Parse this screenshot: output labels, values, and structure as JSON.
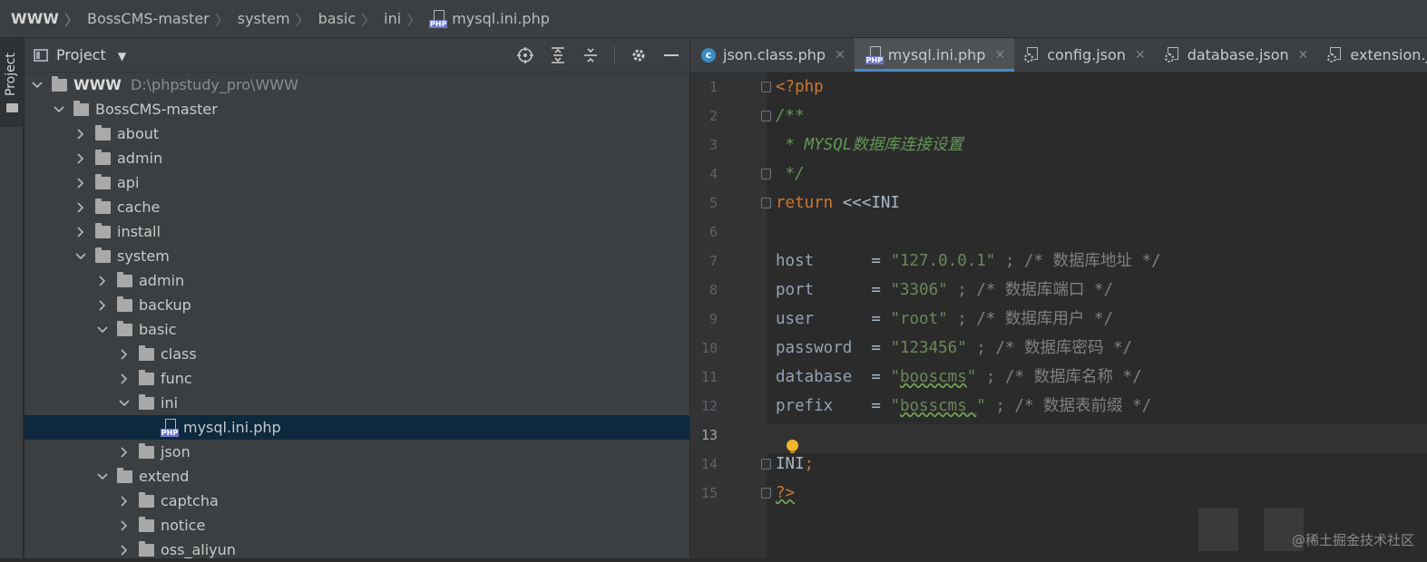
{
  "breadcrumb": {
    "items": [
      "WWW",
      "BossCMS-master",
      "system",
      "basic",
      "ini",
      "mysql.ini.php"
    ]
  },
  "toolstrip": {
    "project_tab": "Project"
  },
  "project_panel": {
    "title": "Project",
    "tree": [
      {
        "label": "WWW",
        "hint": "D:\\phpstudy_pro\\WWW",
        "depth": 0,
        "state": "open",
        "type": "folder"
      },
      {
        "label": "BossCMS-master",
        "depth": 1,
        "state": "open",
        "type": "folder"
      },
      {
        "label": "about",
        "depth": 2,
        "state": "closed",
        "type": "folder"
      },
      {
        "label": "admin",
        "depth": 2,
        "state": "closed",
        "type": "folder"
      },
      {
        "label": "api",
        "depth": 2,
        "state": "closed",
        "type": "folder"
      },
      {
        "label": "cache",
        "depth": 2,
        "state": "closed",
        "type": "folder"
      },
      {
        "label": "install",
        "depth": 2,
        "state": "closed",
        "type": "folder"
      },
      {
        "label": "system",
        "depth": 2,
        "state": "open",
        "type": "folder"
      },
      {
        "label": "admin",
        "depth": 3,
        "state": "closed",
        "type": "folder"
      },
      {
        "label": "backup",
        "depth": 3,
        "state": "closed",
        "type": "folder"
      },
      {
        "label": "basic",
        "depth": 3,
        "state": "open",
        "type": "folder"
      },
      {
        "label": "class",
        "depth": 4,
        "state": "closed",
        "type": "folder"
      },
      {
        "label": "func",
        "depth": 4,
        "state": "closed",
        "type": "folder"
      },
      {
        "label": "ini",
        "depth": 4,
        "state": "open",
        "type": "folder"
      },
      {
        "label": "mysql.ini.php",
        "depth": 5,
        "state": "leaf",
        "type": "php",
        "selected": true
      },
      {
        "label": "json",
        "depth": 4,
        "state": "closed",
        "type": "folder"
      },
      {
        "label": "extend",
        "depth": 3,
        "state": "open",
        "type": "folder"
      },
      {
        "label": "captcha",
        "depth": 4,
        "state": "closed",
        "type": "folder"
      },
      {
        "label": "notice",
        "depth": 4,
        "state": "closed",
        "type": "folder"
      },
      {
        "label": "oss_aliyun",
        "depth": 4,
        "state": "closed",
        "type": "folder"
      }
    ]
  },
  "tabs": [
    {
      "label": "json.class.php",
      "icon": "class-icon",
      "active": false
    },
    {
      "label": "mysql.ini.php",
      "icon": "php-file-icon",
      "active": true
    },
    {
      "label": "config.json",
      "icon": "config-file-icon",
      "active": false
    },
    {
      "label": "database.json",
      "icon": "config-file-icon",
      "active": false
    },
    {
      "label": "extension.json",
      "icon": "config-file-icon",
      "active": false
    }
  ],
  "code": {
    "line_numbers": [
      "1",
      "2",
      "3",
      "4",
      "5",
      "6",
      "7",
      "8",
      "9",
      "10",
      "11",
      "12",
      "13",
      "14",
      "15"
    ],
    "current_line": 13,
    "lines": {
      "l1": "<?php",
      "l2": "/**",
      "l3": " * MYSQL数据库连接设置",
      "l4": " */",
      "l5_kw": "return",
      "l5_rest": " <<<INI",
      "l7_key": "host      ",
      "l7_eq": "= ",
      "l7_val": "\"127.0.0.1\"",
      "l7_cmt": " ; /* 数据库地址 */",
      "l8_key": "port      ",
      "l8_eq": "= ",
      "l8_val": "\"3306\"",
      "l8_cmt": " ; /* 数据库端口 */",
      "l9_key": "user      ",
      "l9_eq": "= ",
      "l9_val": "\"root\"",
      "l9_cmt": " ; /* 数据库用户 */",
      "l10_key": "password  ",
      "l10_eq": "= ",
      "l10_val": "\"123456\"",
      "l10_cmt": " ; /* 数据库密码 */",
      "l11_key": "database  ",
      "l11_eq": "= ",
      "l11_q1": "\"",
      "l11_val": "booscms",
      "l11_q2": "\"",
      "l11_cmt": " ; /* 数据库名称 */",
      "l12_key": "prefix    ",
      "l12_eq": "= ",
      "l12_q1": "\"",
      "l12_val": "bosscms_",
      "l12_q2": "\"",
      "l12_cmt": " ; /* 数据表前缀 */",
      "l14_text": "INI",
      "l14_semi": ";",
      "l15": "?>"
    }
  },
  "watermark": "@稀土掘金技术社区",
  "colors": {
    "accent": "#4a88c7",
    "selection": "#0d293e",
    "keyword": "#cc7832",
    "string": "#6a8759",
    "doc_comment": "#629755",
    "comment": "#808080"
  }
}
